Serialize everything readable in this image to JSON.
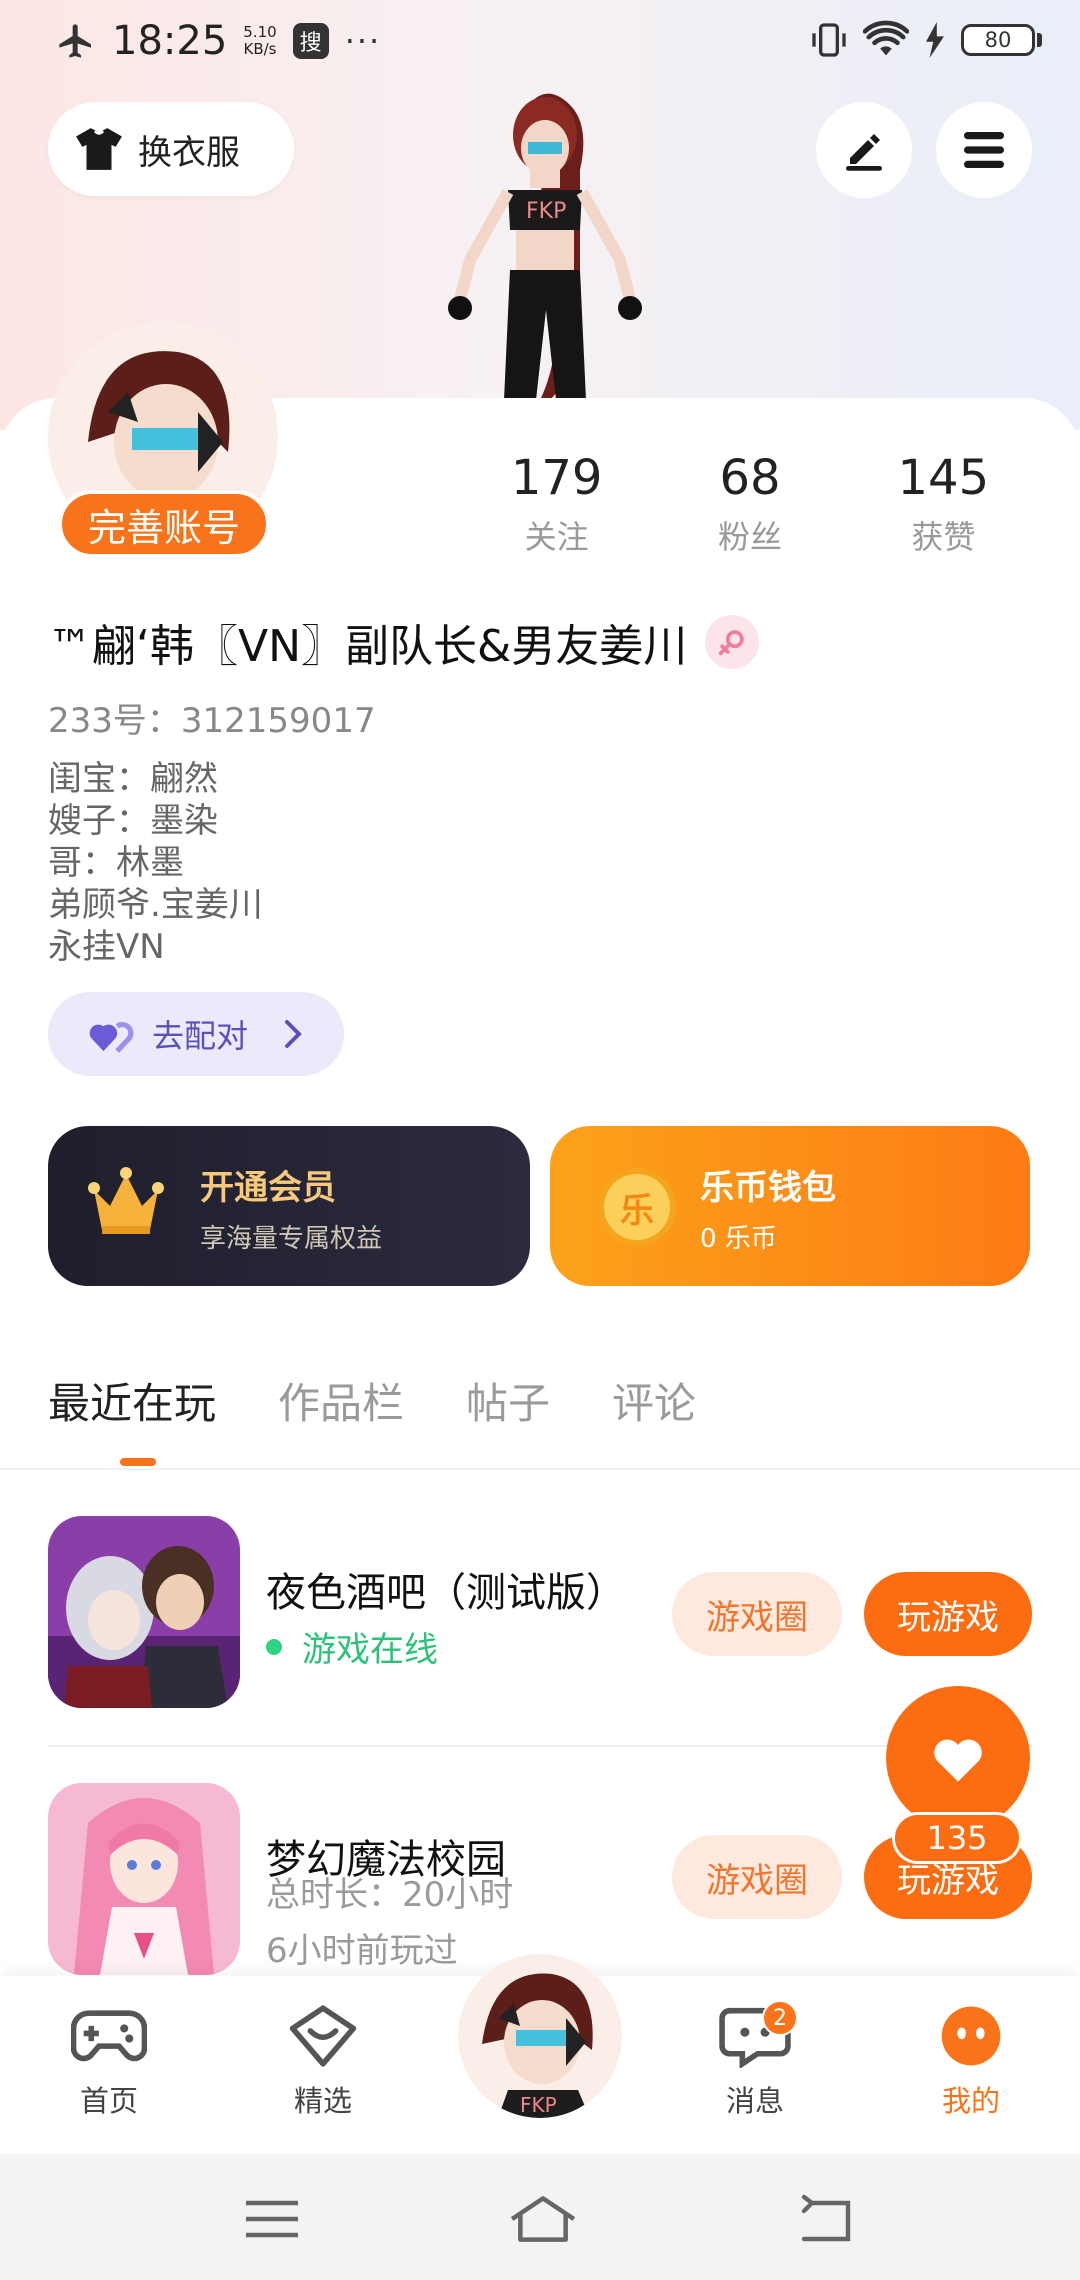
{
  "status_bar": {
    "time": "18:25",
    "speed_value": "5.10",
    "speed_unit": "KB/s",
    "search_badge": "搜",
    "more": "···",
    "battery": "80"
  },
  "header": {
    "dress_label": "换衣服"
  },
  "profile": {
    "complete_label": "完善账号",
    "stats": [
      {
        "value": "179",
        "label": "关注"
      },
      {
        "value": "68",
        "label": "粉丝"
      },
      {
        "value": "145",
        "label": "获赞"
      }
    ],
    "username": "™翩‘韩〖VN〗副队长&男友姜川",
    "uid": "233号：312159017",
    "bio": [
      "闺宝：翩然",
      "嫂子：墨染",
      "哥：林墨",
      "弟顾爷.宝姜川",
      "永挂VN"
    ],
    "pair_label": "去配对"
  },
  "vip": {
    "title": "开通会员",
    "subtitle": "享海量专属权益"
  },
  "wallet": {
    "title": "乐币钱包",
    "subtitle": "0 乐币",
    "coin_glyph": "乐"
  },
  "tabs": [
    {
      "label": "最近在玩",
      "active": true
    },
    {
      "label": "作品栏",
      "active": false
    },
    {
      "label": "帖子",
      "active": false
    },
    {
      "label": "评论",
      "active": false
    }
  ],
  "games": [
    {
      "name": "夜色酒吧（测试版）",
      "status": "游戏在线",
      "circle_label": "游戏圈",
      "play_label": "玩游戏"
    },
    {
      "name": "梦幻魔法校园",
      "duration": "总时长：20小时",
      "last_played": "6小时前玩过",
      "circle_label": "游戏圈",
      "play_label": "玩游戏"
    }
  ],
  "like_fab": {
    "count": "135"
  },
  "bottom_nav": [
    {
      "label": "首页",
      "icon": "gamepad-icon"
    },
    {
      "label": "精选",
      "icon": "heart-box-icon"
    },
    {
      "label": "",
      "icon": "avatar"
    },
    {
      "label": "消息",
      "icon": "chat-icon",
      "badge": "2"
    },
    {
      "label": "我的",
      "icon": "face-icon",
      "active": true
    }
  ],
  "colors": {
    "accent": "#f8731a",
    "online": "#2fc17a",
    "vip_gold": "#f7c97c",
    "pair_purple": "#5a50b8"
  }
}
